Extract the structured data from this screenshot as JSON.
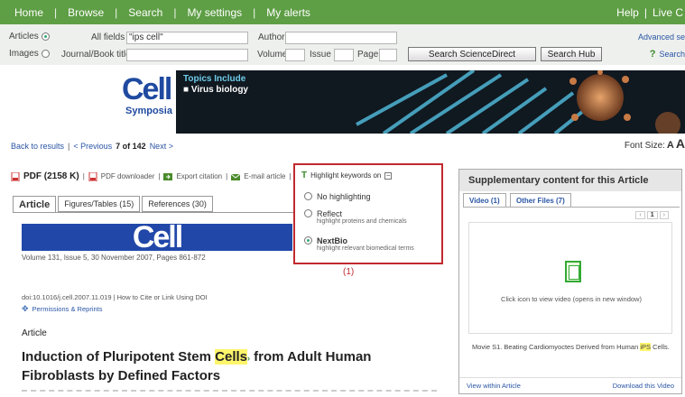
{
  "topnav": {
    "items": [
      "Home",
      "Browse",
      "Search",
      "My settings",
      "My alerts"
    ],
    "right": [
      "Help",
      "Live C"
    ]
  },
  "search": {
    "articles_label": "Articles",
    "images_label": "Images",
    "all_fields_label": "All fields",
    "all_fields_value": "\"ips cell\"",
    "author_label": "Author",
    "journal_label": "Journal/Book title",
    "volume_label": "Volume",
    "issue_label": "Issue",
    "page_label": "Page",
    "search_sd_button": "Search ScienceDirect",
    "search_hub_button": "Search Hub",
    "advanced": "Advanced se",
    "search_tips": "Search"
  },
  "banner": {
    "logo_big": "Cell",
    "logo_small": "Symposia",
    "promo_title": "Topics Include",
    "promo_item": "Virus biology"
  },
  "nav": {
    "back": "Back to results",
    "prev": "< Previous",
    "position": "7 of 142",
    "next": "Next >",
    "font_size_label": "Font Size:",
    "font_a_small": "A",
    "font_a_large": "A"
  },
  "tools": {
    "pdf": "PDF (2158 K)",
    "pdf_downloader": "PDF downloader",
    "export": "Export citation",
    "email": "E-mail article",
    "highlight": "Highlight keywords on"
  },
  "popup": {
    "options": [
      {
        "label": "No highlighting",
        "sub": ""
      },
      {
        "label": "Reflect",
        "sub": "highlight proteins and chemicals"
      },
      {
        "label": "NextBio",
        "sub": "highlight relevant biomedical terms"
      }
    ],
    "number": "(1)"
  },
  "tabs": [
    "Article",
    "Figures/Tables (15)",
    "References (30)"
  ],
  "article": {
    "journal": "Cell",
    "volume": "Volume 131, Issue 5, 30 November 2007, Pages 861-872",
    "doi": "doi:10.1016/j.cell.2007.11.019 | How to Cite or Link Using DOI",
    "permissions": "Permissions & Reprints",
    "label": "Article",
    "title_a": "Induction of Pluripotent Stem ",
    "title_hl": "Cells",
    "title_b": " from Adult Human Fibroblasts by Defined Factors"
  },
  "supp": {
    "header": "Supplementary content for this Article",
    "tab_video": "Video (1)",
    "tab_files": "Other Files (7)",
    "page": "1",
    "click_text": "Click icon to view video (opens in new window)",
    "caption_a": "Movie S1. Beating Cardiomyoctes Derived from Human ",
    "caption_hl": "iPS",
    "caption_b": " Cells.",
    "view_within": "View within Article",
    "download": "Download this Video"
  },
  "colors": {
    "nav_green": "#5e9e45",
    "highlight": "#fdf56b",
    "popup_border": "#c0292f",
    "cell_blue": "#2147a8"
  }
}
